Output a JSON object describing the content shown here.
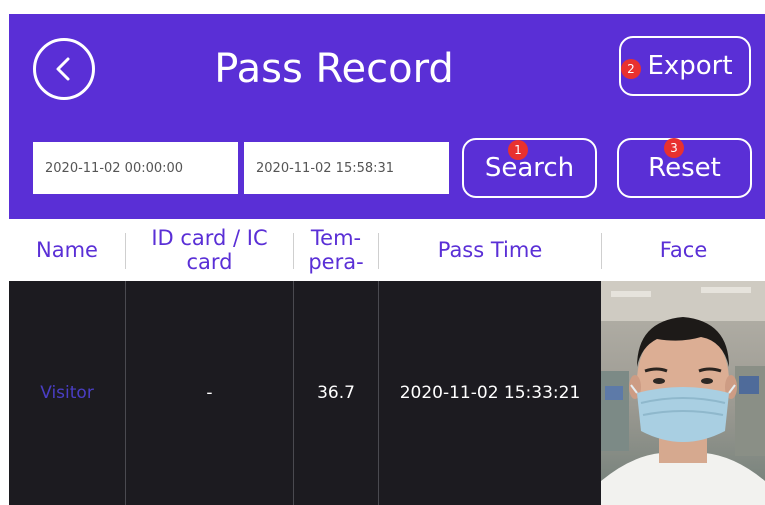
{
  "header": {
    "title": "Pass Record",
    "export_label": "Export",
    "export_badge": "2"
  },
  "filters": {
    "start_time": "2020-11-02 00:00:00",
    "end_time": "2020-11-02 15:58:31",
    "search_label": "Search",
    "search_badge": "1",
    "reset_label": "Reset",
    "reset_badge": "3"
  },
  "table": {
    "columns": [
      "Name",
      "ID card / IC card",
      "Tem-\npera-",
      "Pass Time",
      "Face"
    ],
    "rows": [
      {
        "name": "Visitor",
        "id_card": "-",
        "temperature": "36.7",
        "pass_time": "2020-11-02 15:33:21",
        "face": "face-photo"
      }
    ]
  },
  "colors": {
    "brand": "#5a2fd6",
    "badge": "#e8312f",
    "row_bg": "#1c1b20",
    "visitor_text": "#4a3ec4"
  },
  "icons": {
    "back": "chevron-left-circle-icon"
  }
}
